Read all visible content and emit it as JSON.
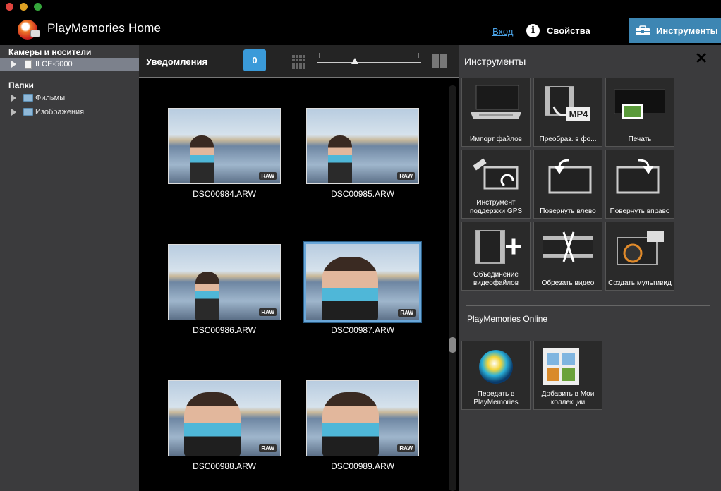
{
  "app": {
    "title": "PlayMemories Home"
  },
  "header": {
    "login": "Вход",
    "properties": "Свойства",
    "tools_button": "Инструменты"
  },
  "sidebar": {
    "cameras_title": "Камеры и носители",
    "camera_item": "ILCE-5000",
    "folders_title": "Папки",
    "folders": [
      "Фильмы",
      "Изображения"
    ]
  },
  "toolbar": {
    "notifications": "Уведомления",
    "notifications_count": "0"
  },
  "photos": [
    "DSC00984.ARW",
    "DSC00985.ARW",
    "DSC00986.ARW",
    "DSC00987.ARW",
    "DSC00988.ARW",
    "DSC00989.ARW"
  ],
  "raw_badge": "RAW",
  "selected_photo": "DSC00987.ARW",
  "tools_panel": {
    "title": "Инструменты",
    "tools": [
      {
        "label": "Импорт файлов",
        "icon": "laptop-icon"
      },
      {
        "label": "Преобраз. в фо...",
        "icon": "convert-mp4-icon",
        "badge": "MP4"
      },
      {
        "label": "Печать",
        "icon": "printer-icon"
      },
      {
        "label": "Инструмент поддержки GPS",
        "icon": "gps-satellite-icon"
      },
      {
        "label": "Повернуть влево",
        "icon": "rotate-left-icon"
      },
      {
        "label": "Повернуть вправо",
        "icon": "rotate-right-icon"
      },
      {
        "label": "Объединение видеофайлов",
        "icon": "merge-video-icon"
      },
      {
        "label": "Обрезать видео",
        "icon": "trim-video-icon"
      },
      {
        "label": "Создать мультивид",
        "icon": "multiview-icon"
      }
    ],
    "online_title": "PlayMemories Online",
    "online_tools": [
      {
        "label": "Передать в PlayMemories",
        "icon": "playmemories-orb-icon"
      },
      {
        "label": "Добавить в Мои коллекции",
        "icon": "collection-window-icon"
      }
    ]
  },
  "colors": {
    "accent": "#3d86b3",
    "badge": "#3a9ad9",
    "link": "#4ba3e6",
    "panel": "#3b3b3d"
  }
}
